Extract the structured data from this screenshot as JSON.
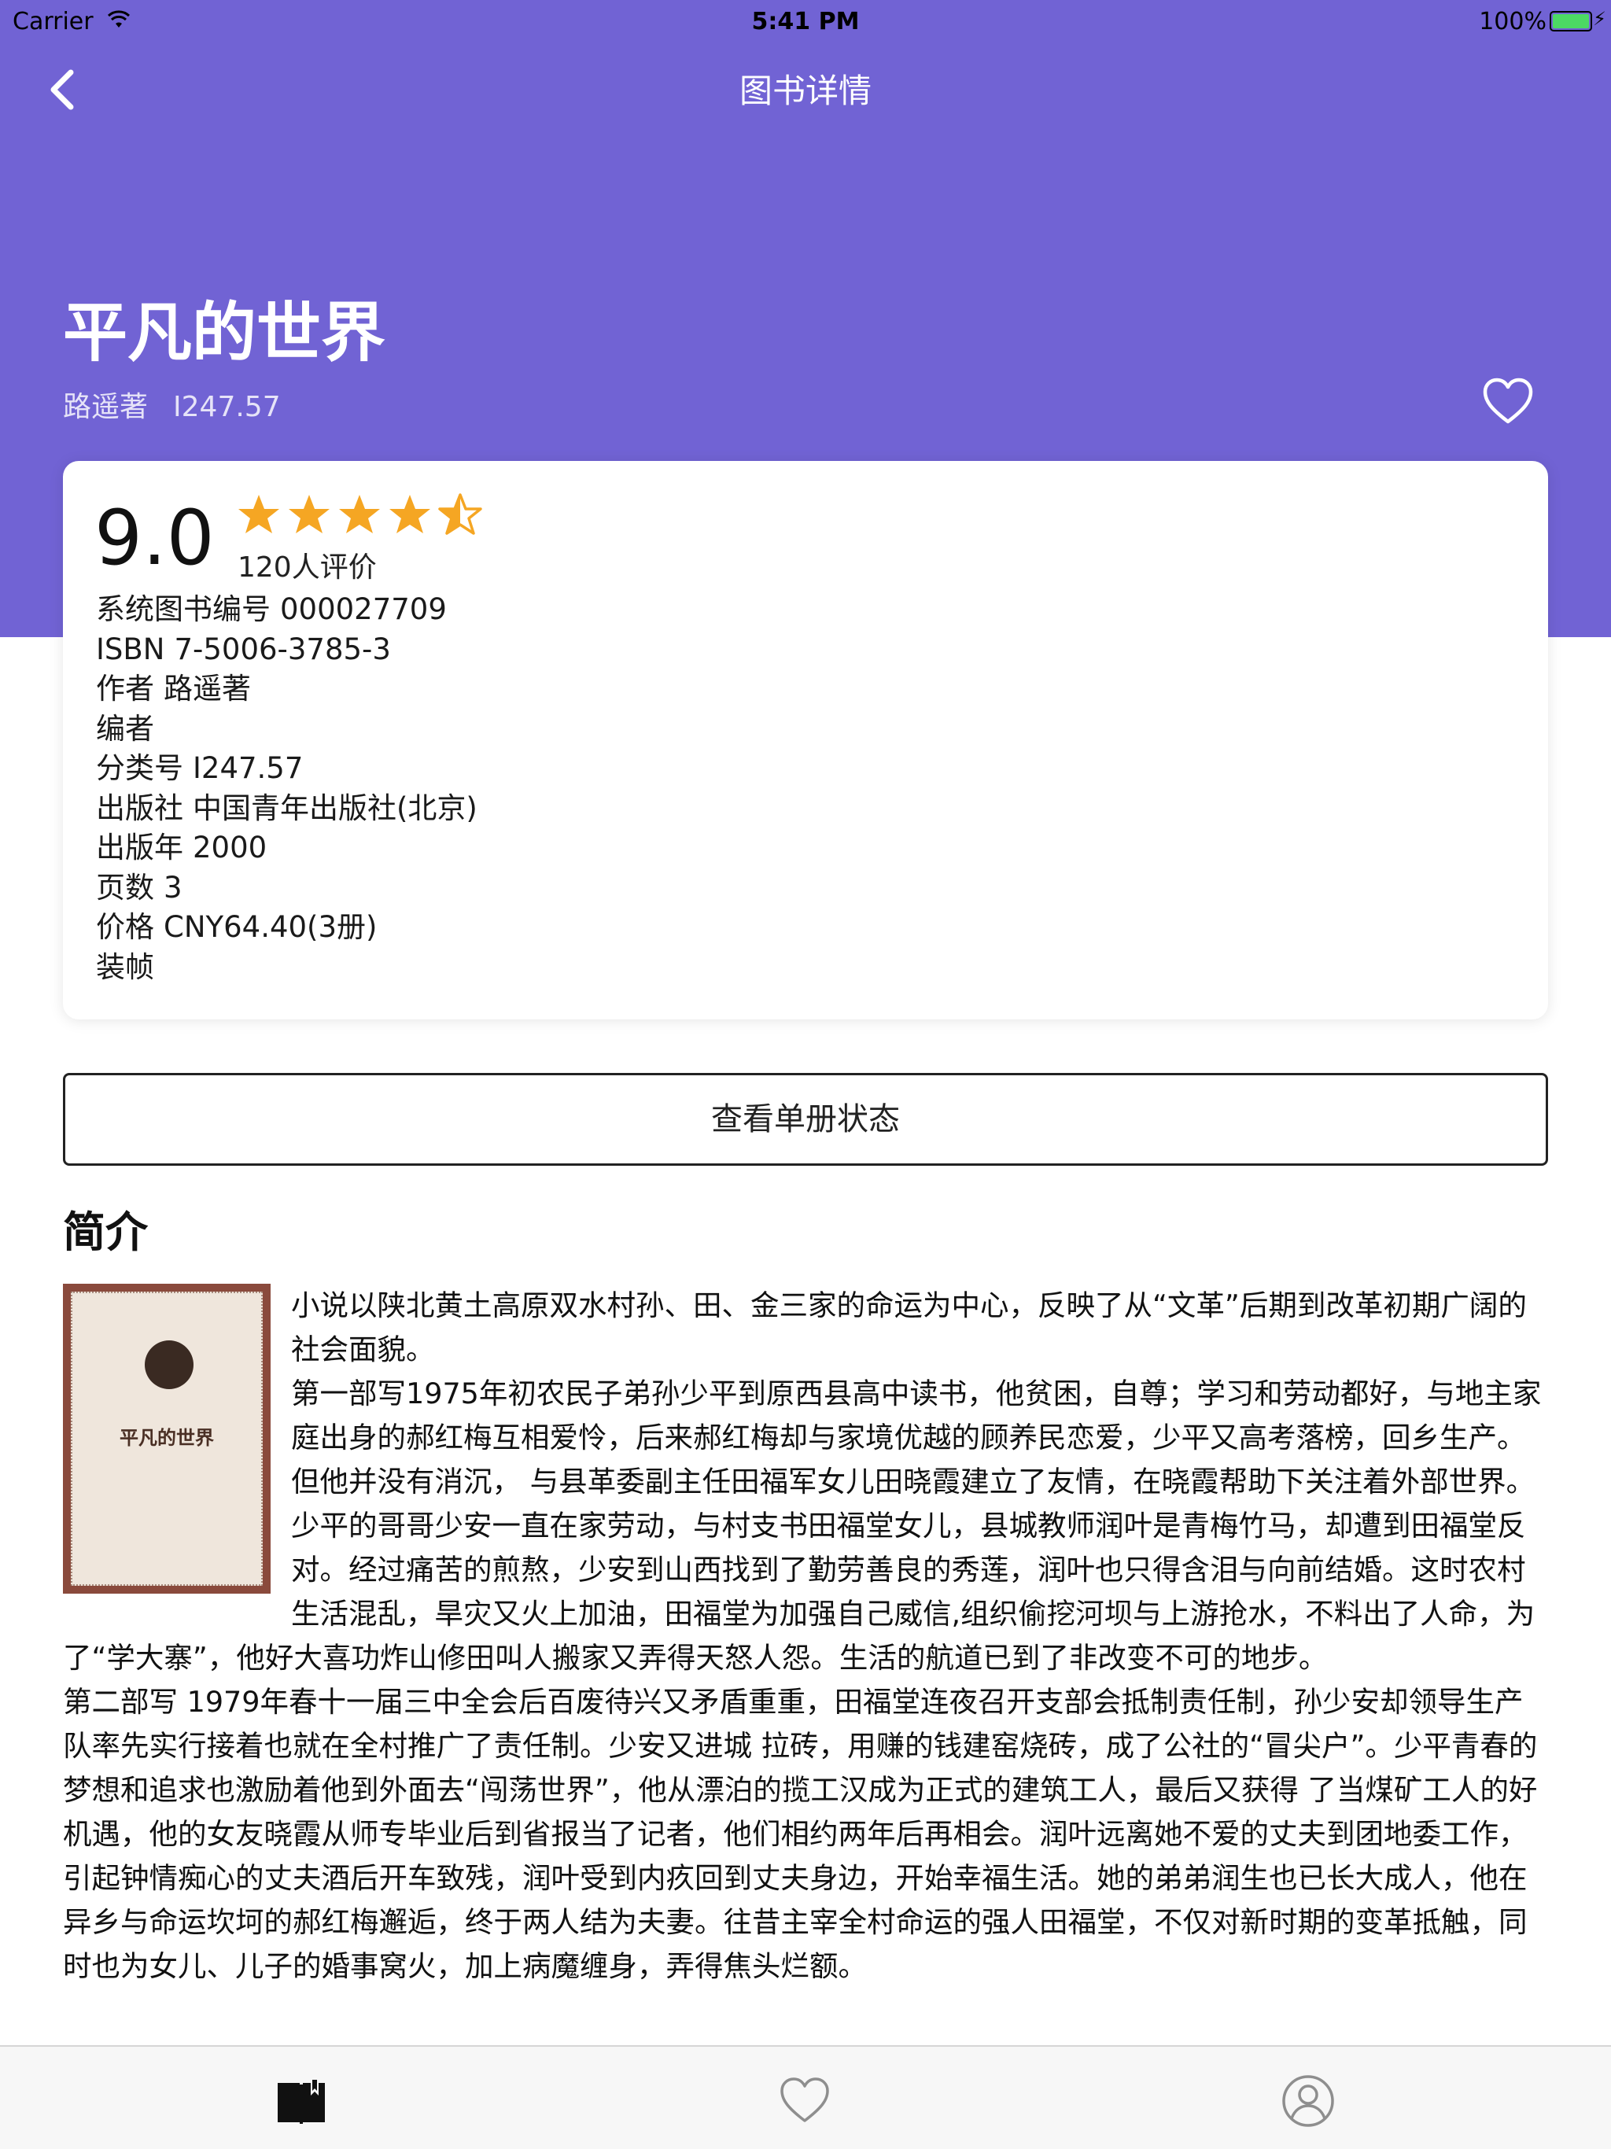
{
  "status_bar": {
    "carrier": "Carrier",
    "time": "5:41 PM",
    "battery": "100%"
  },
  "nav": {
    "title": "图书详情"
  },
  "book": {
    "title": "平凡的世界",
    "author": "路遥著",
    "call_number": "I247.57"
  },
  "rating": {
    "score": "9.0",
    "stars": 4.5,
    "count_label": "120人评价",
    "star_color": "#f5a623"
  },
  "info_rows": [
    {
      "label": "系统图书编号",
      "value": "000027709"
    },
    {
      "label": "ISBN",
      "value": "7-5006-3785-3"
    },
    {
      "label": "作者",
      "value": "路遥著"
    },
    {
      "label": "编者",
      "value": ""
    },
    {
      "label": "分类号",
      "value": "I247.57"
    },
    {
      "label": "出版社",
      "value": "中国青年出版社(北京)"
    },
    {
      "label": "出版年",
      "value": "2000"
    },
    {
      "label": "页数",
      "value": "3"
    },
    {
      "label": "价格",
      "value": "CNY64.40(3册)"
    },
    {
      "label": "装帧",
      "value": ""
    }
  ],
  "status_button": "查看单册状态",
  "intro": {
    "heading": "简介",
    "cover_title": "平凡的世界",
    "paragraphs": [
      "小说以陕北黄土高原双水村孙、田、金三家的命运为中心，反映了从“文革”后期到改革初期广阔的社会面貌。",
      "第一部写1975年初农民子弟孙少平到原西县高中读书，他贫困，自尊；学习和劳动都好，与地主家庭出身的郝红梅互相爱怜，后来郝红梅却与家境优越的顾养民恋爱，少平又高考落榜，回乡生产。但他并没有消沉， 与县革委副主任田福军女儿田晓霞建立了友情，在晓霞帮助下关注着外部世界。少平的哥哥少安一直在家劳动，与村支书田福堂女儿，县城教师润叶是青梅竹马，却遭到田福堂反对。经过痛苦的煎熬，少安到山西找到了勤劳善良的秀莲，润叶也只得含泪与向前结婚。这时农村生活混乱，旱灾又火上加油，田福堂为加强自己威信,组织偷挖河坝与上游抢水，不料出了人命，为了“学大寨”，他好大喜功炸山修田叫人搬家又弄得天怒人怨。生活的航道已到了非改变不可的地步。",
      "第二部写 1979年春十一届三中全会后百废待兴又矛盾重重，田福堂连夜召开支部会抵制责任制，孙少安却领导生产队率先实行接着也就在全村推广了责任制。少安又进城 拉砖，用赚的钱建窑烧砖，成了公社的“冒尖户”。少平青春的梦想和追求也激励着他到外面去“闯荡世界”，他从漂泊的揽工汉成为正式的建筑工人，最后又获得 了当煤矿工人的好机遇，他的女友晓霞从师专毕业后到省报当了记者，他们相约两年后再相会。润叶远离她不爱的丈夫到团地委工作，引起钟情痴心的丈夫酒后开车致残，润叶受到内疚回到丈夫身边，开始幸福生活。她的弟弟润生也已长大成人，他在异乡与命运坎坷的郝红梅邂逅，终于两人结为夫妻。往昔主宰全村命运的强人田福堂，不仅对新时期的变革抵触，同时也为女儿、儿子的婚事窝火，加上病魔缠身，弄得焦头烂额。"
    ]
  },
  "tabs": [
    {
      "name": "library",
      "icon": "book-icon"
    },
    {
      "name": "favorites",
      "icon": "heart-icon"
    },
    {
      "name": "profile",
      "icon": "user-icon"
    }
  ],
  "colors": {
    "header": "#7163d4",
    "accent_star": "#f5a623",
    "tab_active": "#111111",
    "tab_inactive": "#8e8e8e"
  }
}
